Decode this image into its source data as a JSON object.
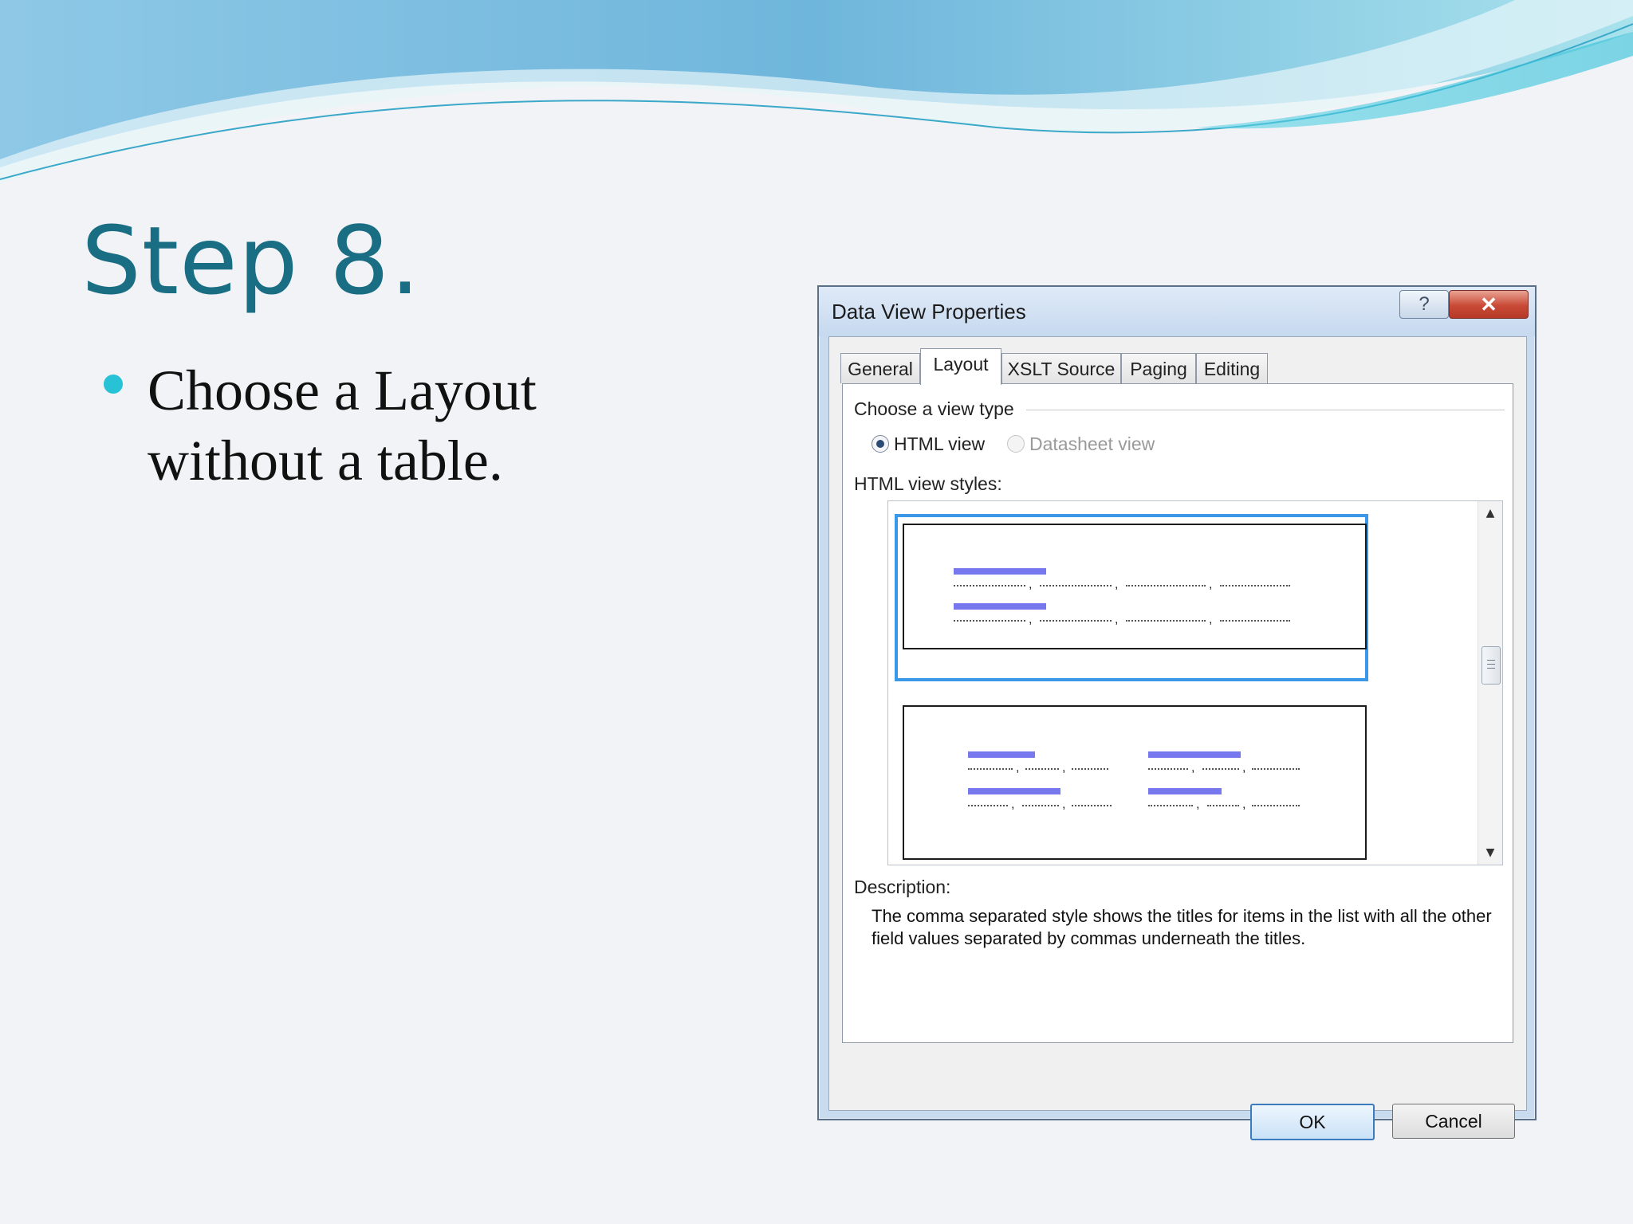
{
  "slide": {
    "title": "Step 8.",
    "bullet_text": "Choose a Layout without a table.",
    "accent_color": "#1a6e84",
    "bullet_color": "#27c2d6"
  },
  "dialog": {
    "title": "Data View Properties",
    "help_label": "?",
    "close_label": "✕",
    "tabs": [
      {
        "label": "General",
        "active": false
      },
      {
        "label": "Layout",
        "active": true
      },
      {
        "label": "XSLT Source",
        "active": false
      },
      {
        "label": "Paging",
        "active": false
      },
      {
        "label": "Editing",
        "active": false
      }
    ],
    "view_type_label": "Choose a view type",
    "radio_html_label": "HTML view",
    "radio_html_selected": true,
    "radio_datasheet_label": "Datasheet view",
    "radio_datasheet_enabled": false,
    "styles_label": "HTML view styles:",
    "description_label": "Description:",
    "description_text": "The comma separated style shows the titles for items in the list with all the other field values separated by commas underneath the titles.",
    "ok_label": "OK",
    "cancel_label": "Cancel",
    "selection_color": "#3b97e8"
  },
  "icons": [
    "question-icon",
    "close-icon",
    "radio-selected-icon",
    "radio-disabled-icon",
    "scroll-up-icon",
    "scroll-down-icon",
    "scroll-thumb-grip-icon"
  ]
}
